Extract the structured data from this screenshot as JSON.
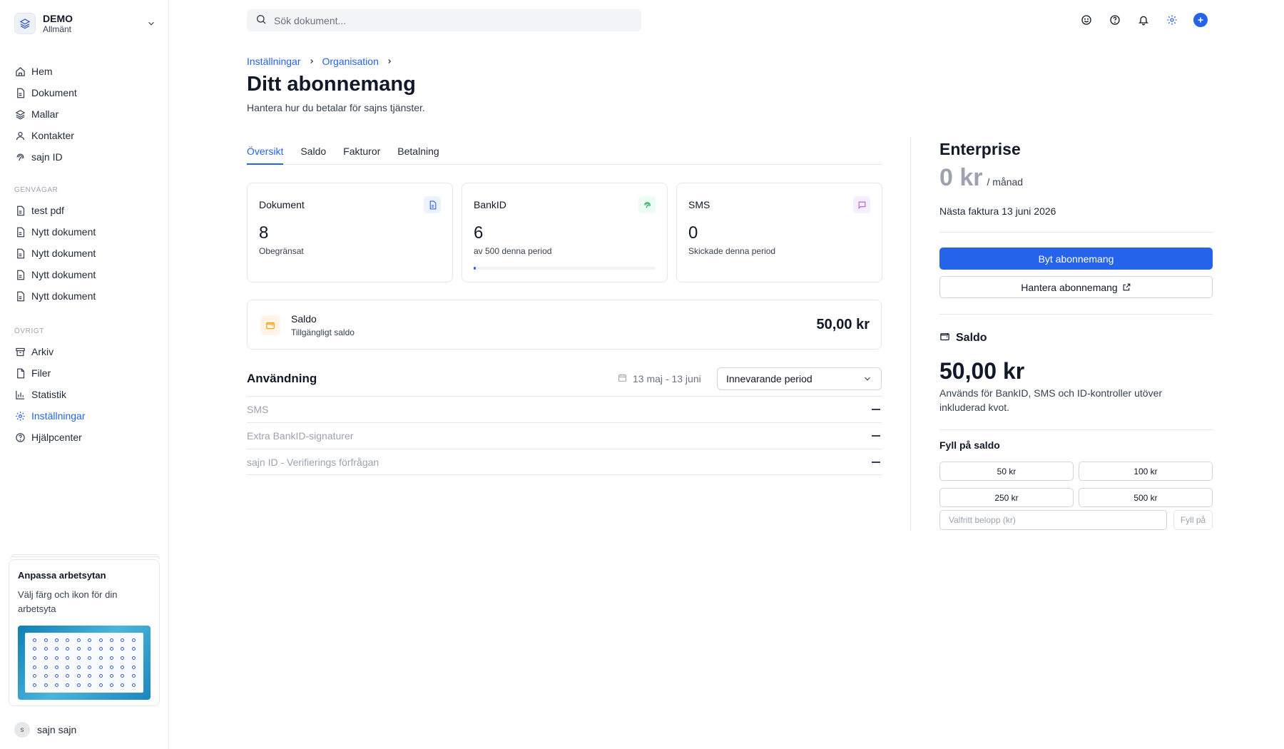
{
  "workspace": {
    "name": "DEMO",
    "subtitle": "Allmänt"
  },
  "nav": {
    "main": [
      {
        "label": "Hem",
        "icon": "home-icon"
      },
      {
        "label": "Dokument",
        "icon": "document-icon"
      },
      {
        "label": "Mallar",
        "icon": "layers-icon"
      },
      {
        "label": "Kontakter",
        "icon": "user-icon"
      },
      {
        "label": "sajn ID",
        "icon": "fingerprint-icon"
      }
    ],
    "shortcuts_label": "GENVÄGAR",
    "shortcuts": [
      {
        "label": "test pdf"
      },
      {
        "label": "Nytt dokument"
      },
      {
        "label": "Nytt dokument"
      },
      {
        "label": "Nytt dokument"
      },
      {
        "label": "Nytt dokument"
      }
    ],
    "other_label": "ÖVRIGT",
    "other": [
      {
        "label": "Arkiv",
        "icon": "archive-icon"
      },
      {
        "label": "Filer",
        "icon": "file-icon"
      },
      {
        "label": "Statistik",
        "icon": "chart-icon"
      },
      {
        "label": "Inställningar",
        "icon": "gear-icon",
        "active": true
      },
      {
        "label": "Hjälpcenter",
        "icon": "help-icon"
      }
    ]
  },
  "promo": {
    "title": "Anpassa arbetsytan",
    "text": "Välj färg och ikon för din arbetsyta"
  },
  "user": {
    "initial": "s",
    "name": "sajn sajn"
  },
  "search": {
    "placeholder": "Sök dokument..."
  },
  "breadcrumb": {
    "items": [
      "Inställningar",
      "Organisation"
    ]
  },
  "page": {
    "title": "Ditt abonnemang",
    "subtitle": "Hantera hur du betalar för sajns tjänster."
  },
  "tabs": [
    {
      "label": "Översikt",
      "active": true
    },
    {
      "label": "Saldo"
    },
    {
      "label": "Fakturor"
    },
    {
      "label": "Betalning"
    }
  ],
  "cards": [
    {
      "title": "Dokument",
      "value": "8",
      "sub": "Obegränsat",
      "icon": "document-icon",
      "accent": "#2563eb",
      "bg": "#eef2ff"
    },
    {
      "title": "BankID",
      "value": "6",
      "sub": "av 500 denna period",
      "icon": "fingerprint-icon",
      "accent": "#16a34a",
      "bg": "#ecfdf3",
      "progress": 0.012
    },
    {
      "title": "SMS",
      "value": "0",
      "sub": "Skickade denna period",
      "icon": "message-icon",
      "accent": "#a855f7",
      "bg": "#f5efff"
    }
  ],
  "saldo_card": {
    "label": "Saldo",
    "sub": "Tillgängligt saldo",
    "amount": "50,00 kr"
  },
  "usage": {
    "title": "Användning",
    "date_range": "13 maj - 13 juni",
    "period": "Innevarande period",
    "rows": [
      {
        "label": "SMS"
      },
      {
        "label": "Extra BankID-signaturer"
      },
      {
        "label": "sajn ID - Verifierings förfrågan"
      }
    ]
  },
  "plan": {
    "name": "Enterprise",
    "price": "0 kr",
    "per": "/ månad",
    "next_invoice": "Nästa faktura 13 juni 2026",
    "change_label": "Byt abonnemang",
    "manage_label": "Hantera abonnemang"
  },
  "right_saldo": {
    "label": "Saldo",
    "amount": "50,00 kr",
    "description": "Används för BankID, SMS och ID-kontroller utöver inkluderad kvot.",
    "topup_label": "Fyll på saldo",
    "amounts": [
      "50 kr",
      "100 kr",
      "250 kr",
      "500 kr"
    ],
    "custom_placeholder": "Valfritt belopp (kr)",
    "fill_label": "Fyll på"
  },
  "colors": {
    "accent": "#2563eb",
    "border": "#e5e7eb",
    "muted": "#9ca3af"
  }
}
